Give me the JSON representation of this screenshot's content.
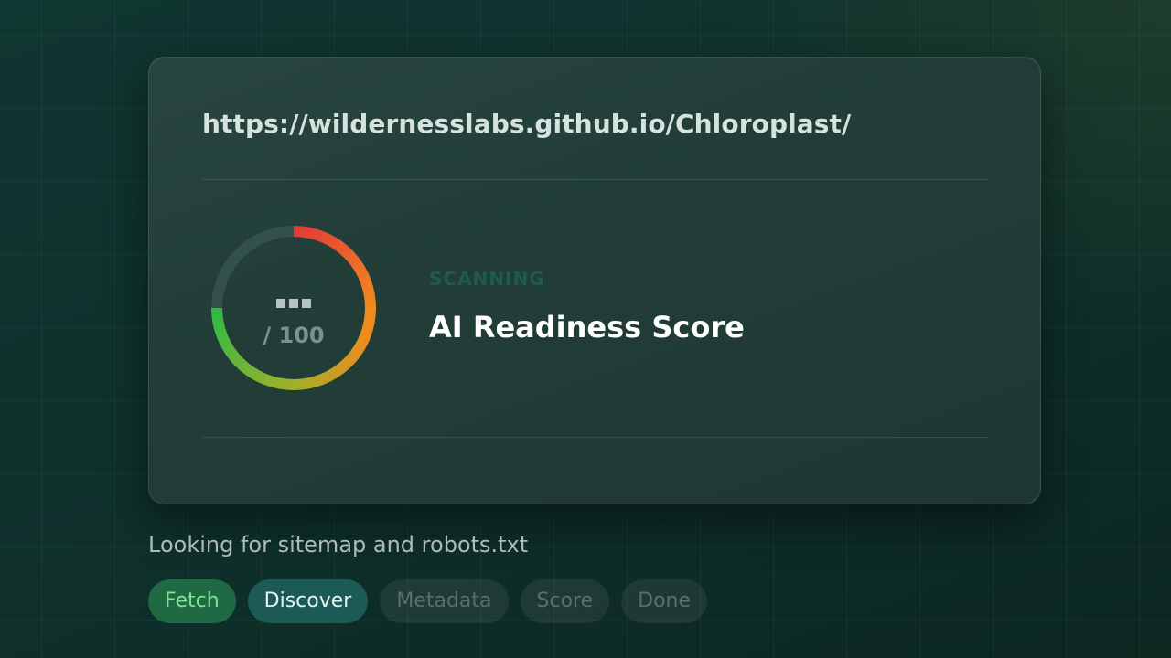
{
  "card": {
    "url": "https://wildernesslabs.github.io/Chloroplast/",
    "gauge": {
      "max_label": "/ 100",
      "value_placeholder": "..."
    },
    "status_label": "SCANNING",
    "title": "AI Readiness Score"
  },
  "caption": "Looking for sitemap and robots.txt",
  "steps": [
    {
      "label": "Fetch",
      "state": "done"
    },
    {
      "label": "Discover",
      "state": "active"
    },
    {
      "label": "Metadata",
      "state": "pending"
    },
    {
      "label": "Score",
      "state": "pending"
    },
    {
      "label": "Done",
      "state": "pending"
    }
  ],
  "colors": {
    "gauge_gradient": [
      "#e23a3a",
      "#f08a1c",
      "#9fb02a",
      "#2fba45"
    ],
    "step_done": "#1f6a43",
    "step_active": "#1c5b55"
  }
}
